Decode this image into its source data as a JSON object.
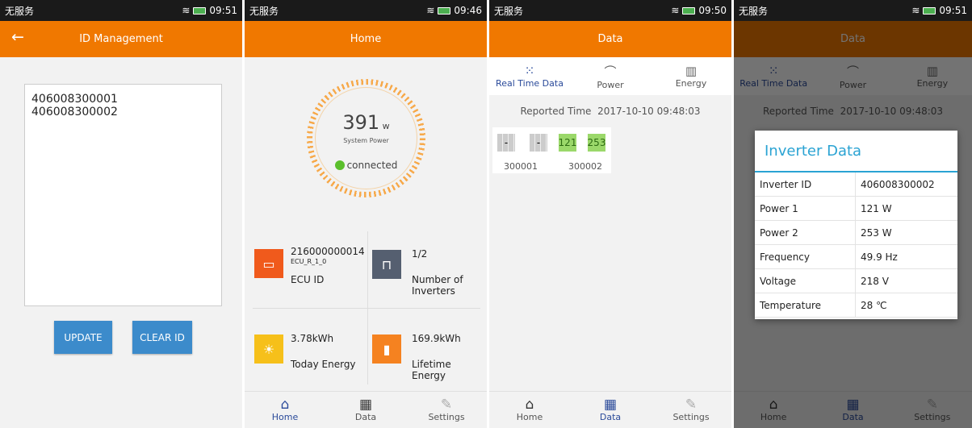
{
  "screen1": {
    "status": {
      "left": "无服务",
      "time": "09:51"
    },
    "title": "ID Management",
    "ids": [
      "406008300001",
      "406008300002"
    ],
    "update_label": "UPDATE",
    "clear_label": "CLEAR ID"
  },
  "screen2": {
    "status": {
      "left": "无服务",
      "time": "09:46"
    },
    "title": "Home",
    "power_value": "391",
    "power_unit": "w",
    "power_label": "System Power",
    "connection": "connected",
    "ecu_id": "216000000014",
    "ecu_version": "ECU_R_1_0",
    "ecu_label": "ECU ID",
    "inverters_value": "1/2",
    "inverters_label": "Number of Inverters",
    "today_value": "3.78kWh",
    "today_label": "Today Energy",
    "lifetime_value": "169.9kWh",
    "lifetime_label": "Lifetime Energy"
  },
  "tabbar": {
    "home": "Home",
    "data": "Data",
    "settings": "Settings"
  },
  "screen3": {
    "status": {
      "left": "无服务",
      "time": "09:50"
    },
    "title": "Data",
    "tabs": {
      "realtime": "Real Time Data",
      "power": "Power",
      "energy": "Energy"
    },
    "reported_label": "Reported Time",
    "reported_time": "2017-10-10 09:48:03",
    "inv1": {
      "id": "300001",
      "p1": "-",
      "p2": "-"
    },
    "inv2": {
      "id": "300002",
      "p1": "121",
      "p2": "253"
    }
  },
  "screen4": {
    "status": {
      "left": "无服务",
      "time": "09:51"
    },
    "dialog_title": "Inverter Data",
    "rows": [
      {
        "k": "Inverter ID",
        "v": "406008300002"
      },
      {
        "k": "Power 1",
        "v": "121 W"
      },
      {
        "k": "Power 2",
        "v": "253 W"
      },
      {
        "k": "Frequency",
        "v": "49.9 Hz"
      },
      {
        "k": "Voltage",
        "v": "218 V"
      },
      {
        "k": "Temperature",
        "v": "28 ℃"
      }
    ]
  },
  "colors": {
    "accent": "#f07800",
    "button": "#3c8bcb",
    "dialog": "#2aa3d3"
  }
}
